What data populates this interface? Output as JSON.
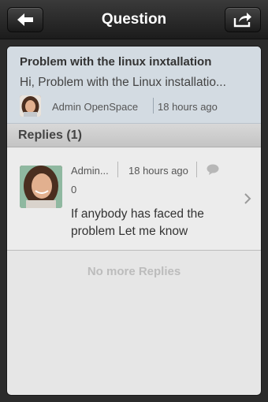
{
  "header": {
    "title": "Question",
    "back_icon": "back-arrow-icon",
    "share_icon": "share-icon"
  },
  "question": {
    "title": "Problem with the linux inxtallation",
    "body": "Hi, Problem with the Linux installatio...",
    "author": "Admin OpenSpace",
    "time": "18 hours ago"
  },
  "replies": {
    "heading": "Replies (1)",
    "items": [
      {
        "author": "Admin...",
        "time": "18 hours ago",
        "comment_count": "0",
        "text": "If anybody has faced the problem Let me know"
      }
    ],
    "end_text": "No more Replies"
  },
  "colors": {
    "navbar": "#1c1c1c",
    "question_bg": "#d3dbe2",
    "panel_bg": "#e6e6e6"
  }
}
